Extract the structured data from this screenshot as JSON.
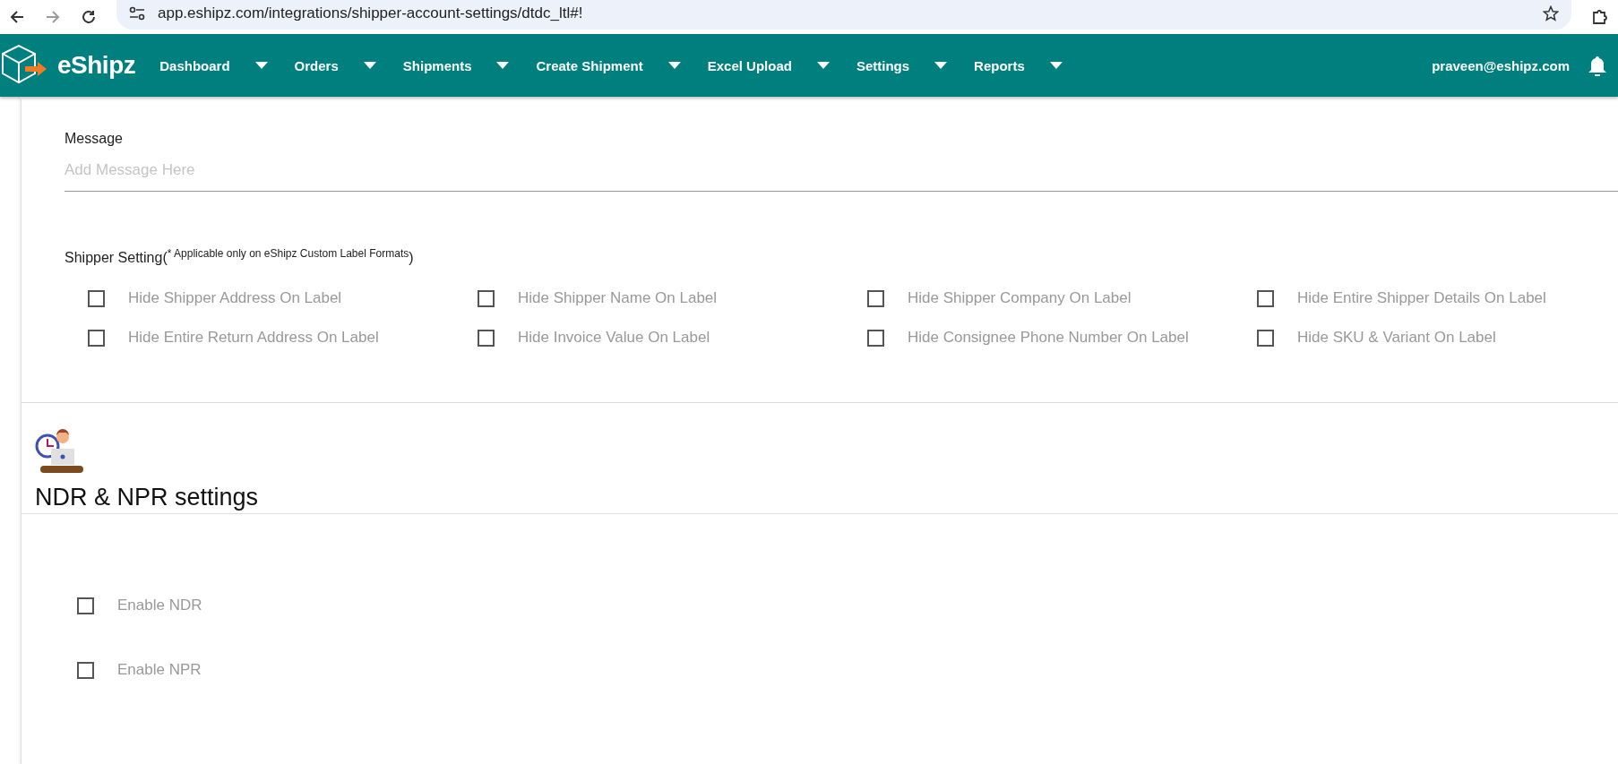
{
  "browser": {
    "url": "app.eshipz.com/integrations/shipper-account-settings/dtdc_ltl#!"
  },
  "navbar": {
    "brand": "eShipz",
    "menu": [
      {
        "label": "Dashboard"
      },
      {
        "label": "Orders"
      },
      {
        "label": "Shipments"
      },
      {
        "label": "Create Shipment"
      },
      {
        "label": "Excel Upload"
      },
      {
        "label": "Settings"
      },
      {
        "label": "Reports"
      }
    ],
    "user_email": "praveen@eshipz.com"
  },
  "message": {
    "label": "Message",
    "placeholder": "Add Message Here"
  },
  "shipper_setting": {
    "title": "Shipper Setting($^{* Applicable only on eShipz Custom Label Formats}$)",
    "options": [
      {
        "label": "Hide Shipper Address On Label",
        "checked": false
      },
      {
        "label": "Hide Shipper Name On Label",
        "checked": false
      },
      {
        "label": "Hide Shipper Company On Label",
        "checked": false
      },
      {
        "label": "Hide Entire Shipper Details On Label",
        "checked": false
      },
      {
        "label": "Hide Entire Return Address On Label",
        "checked": false
      },
      {
        "label": "Hide Invoice Value On Label",
        "checked": false
      },
      {
        "label": "Hide Consignee Phone Number On Label",
        "checked": false
      },
      {
        "label": "Hide SKU & Variant On Label",
        "checked": false
      }
    ]
  },
  "ndr_npr": {
    "title": "NDR & NPR settings",
    "options": [
      {
        "label": "Enable NDR",
        "checked": false
      },
      {
        "label": "Enable NPR",
        "checked": false
      }
    ]
  }
}
